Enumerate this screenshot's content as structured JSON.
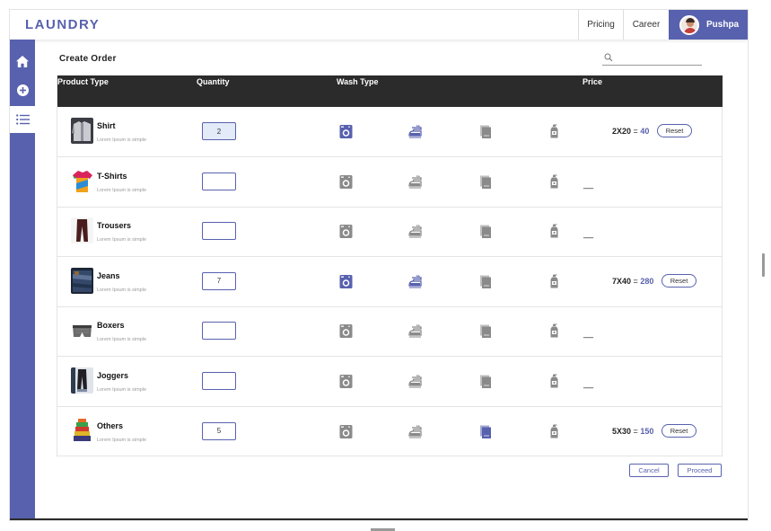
{
  "app": {
    "logo": "LAUNDRY"
  },
  "header": {
    "nav": [
      "Pricing",
      "Career"
    ],
    "user_name": "Pushpa"
  },
  "sidebar": {
    "items": [
      {
        "icon": "home-icon"
      },
      {
        "icon": "plus-circle-icon"
      },
      {
        "icon": "list-icon",
        "active": true
      }
    ]
  },
  "main": {
    "title": "Create Order",
    "search_placeholder": ""
  },
  "table": {
    "headers": [
      "Product Type",
      "Quantity",
      "Wash Type",
      "Price"
    ],
    "wash_types": [
      "washing-machine-icon",
      "iron-icon",
      "towel-icon",
      "bleach-icon"
    ],
    "rows": [
      {
        "name": "Shirt",
        "desc": "Lorem Ipsum is simple",
        "qty": "2",
        "active": [
          true,
          true,
          false,
          false
        ],
        "price_calc": "2X20",
        "price_total": "40",
        "reset": "Reset"
      },
      {
        "name": "T-Shirts",
        "desc": "Lorem Ipsum is simple",
        "qty": "",
        "active": [
          false,
          false,
          false,
          false
        ],
        "price_dash": "__"
      },
      {
        "name": "Trousers",
        "desc": "Lorem Ipsum is simple",
        "qty": "",
        "active": [
          false,
          false,
          false,
          false
        ],
        "price_dash": "__"
      },
      {
        "name": "Jeans",
        "desc": "Lorem Ipsum is simple",
        "qty": "7",
        "active": [
          true,
          true,
          false,
          false
        ],
        "price_calc": "7X40",
        "price_total": "280",
        "reset": "Reset"
      },
      {
        "name": "Boxers",
        "desc": "Lorem Ipsum is simple",
        "qty": "",
        "active": [
          false,
          false,
          false,
          false
        ],
        "price_dash": "__"
      },
      {
        "name": "Joggers",
        "desc": "Lorem Ipsum is simple",
        "qty": "",
        "active": [
          false,
          false,
          false,
          false
        ],
        "price_dash": "__"
      },
      {
        "name": "Others",
        "desc": "Lorem Ipsum is simple",
        "qty": "5",
        "active": [
          false,
          false,
          true,
          false
        ],
        "price_calc": "5X30",
        "price_total": "150",
        "reset": "Reset"
      }
    ]
  },
  "actions": {
    "cancel": "Cancel",
    "proceed": "Proceed"
  },
  "colors": {
    "accent": "#5861AE",
    "header_dark": "#2b2b2b",
    "inactive_icon": "#8a8a8a"
  }
}
